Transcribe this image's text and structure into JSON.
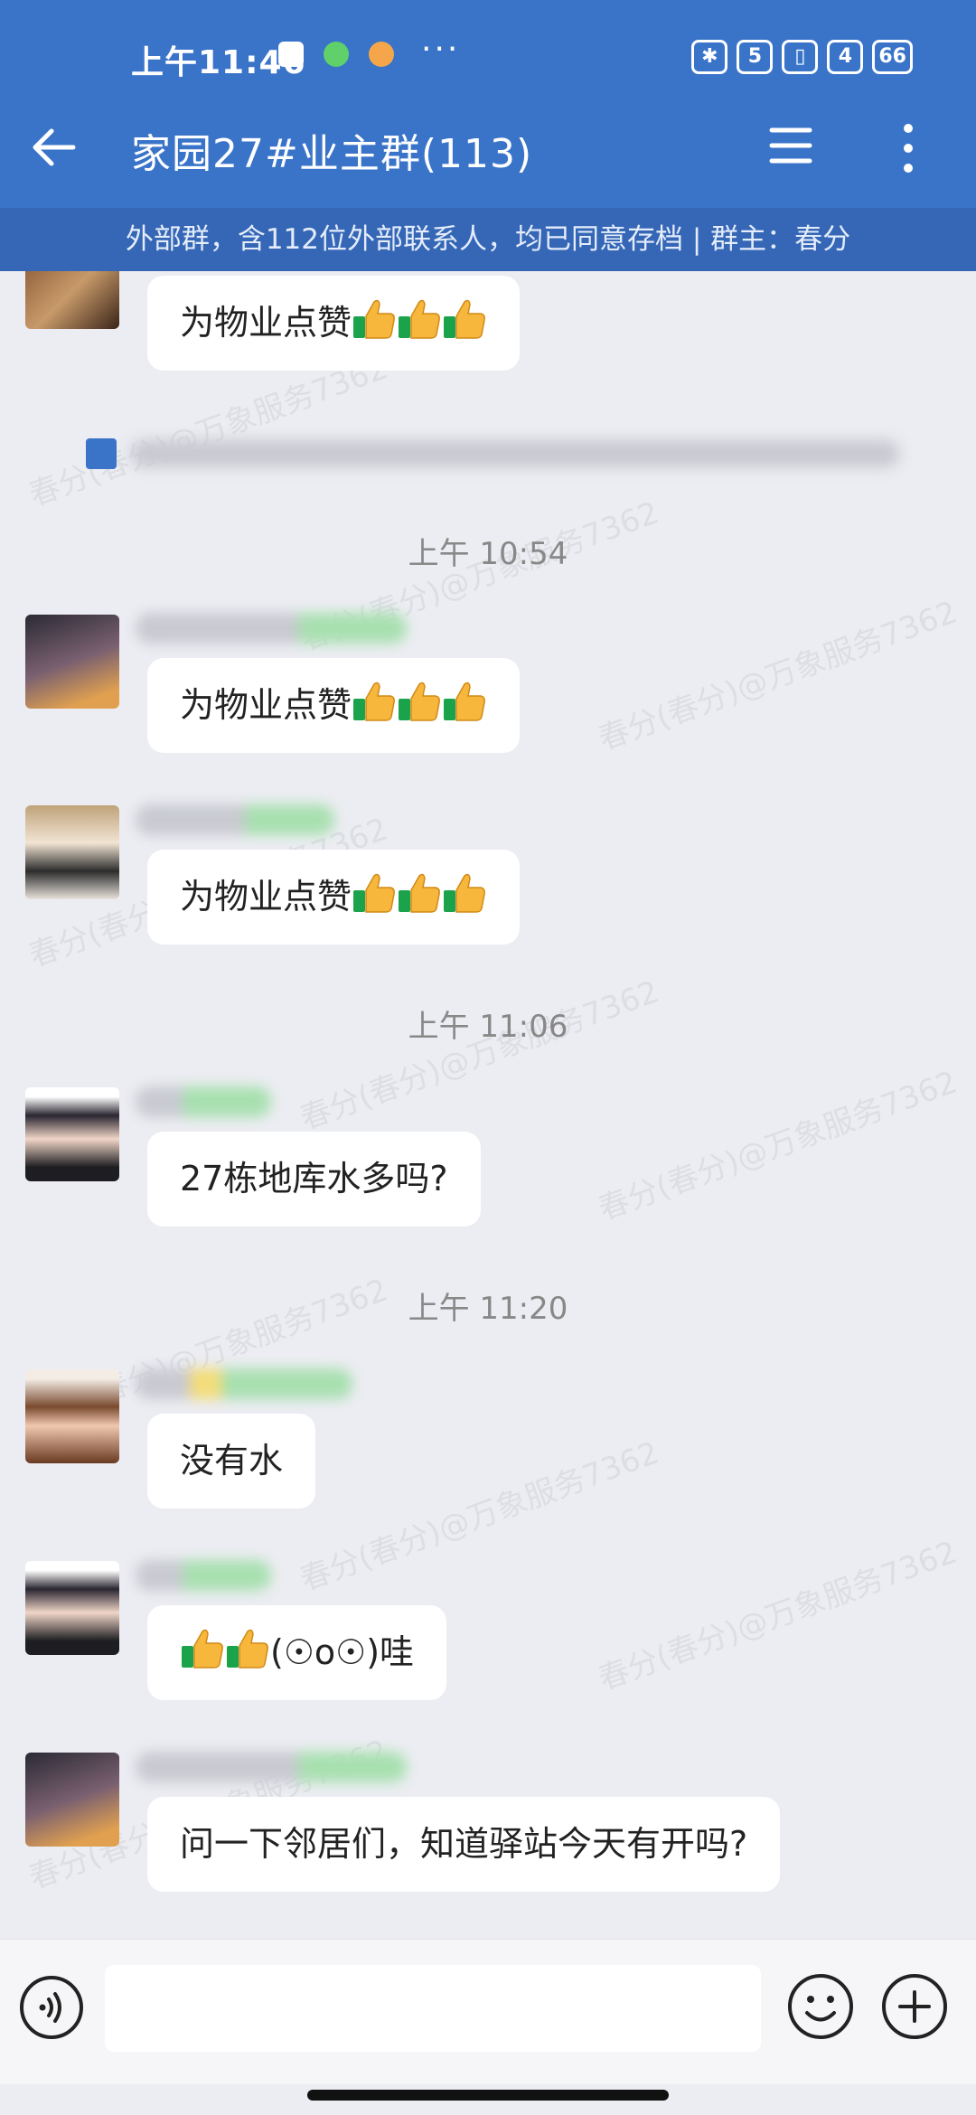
{
  "status_bar": {
    "time": "上午11:46",
    "dots": "···",
    "indicators": [
      "5",
      "4",
      "66"
    ]
  },
  "header": {
    "title": "家园27#业主群(113)",
    "banner": "外部群，含112位外部联系人，均已同意存档 | 群主：春分"
  },
  "watermark_text": "春分(春分)@万象服务7362",
  "timestamps": [
    "上午 10:54",
    "上午 11:06",
    "上午 11:20"
  ],
  "messages": [
    {
      "text": "为物业点赞",
      "thumbs": 3
    },
    {
      "text": "为物业点赞",
      "thumbs": 3
    },
    {
      "text": "为物业点赞",
      "thumbs": 3
    },
    {
      "text": "27栋地库水多吗?"
    },
    {
      "text": "没有水"
    },
    {
      "text_before": "",
      "thumbs": 2,
      "text": "(☉o☉)哇"
    },
    {
      "text": "问一下邻居们，知道驿站今天有开吗?"
    }
  ],
  "input": {
    "placeholder": ""
  },
  "colors": {
    "header": "#3a74c9",
    "banner": "#3567b6",
    "background": "#ecedf2"
  },
  "icons": [
    "back-arrow-icon",
    "menu-icon",
    "more-vertical-icon",
    "voice-icon",
    "emoji-icon",
    "plus-icon",
    "thumbs-up-icon"
  ]
}
